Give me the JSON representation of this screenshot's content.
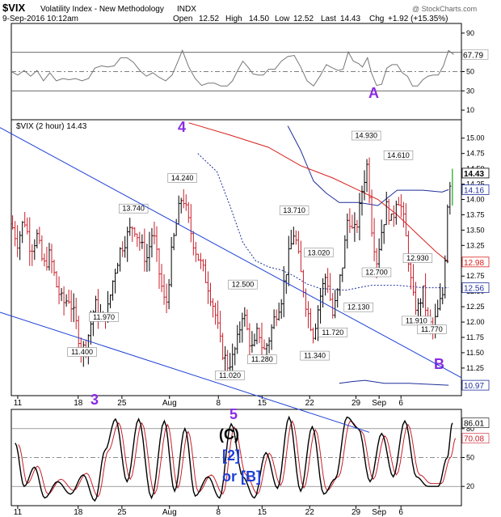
{
  "header": {
    "symbol": "$VIX",
    "name": "Volatility Index - New Methodology",
    "exchange": "INDX",
    "timestamp": "9-Sep-2016 10:12am",
    "watermark": "@ StockCharts.com",
    "open_label": "Open",
    "open": "12.52",
    "high_label": "High",
    "high": "14.50",
    "low_label": "Low",
    "low": "12.52",
    "last_label": "Last",
    "last": "14.43",
    "chg_label": "Chg",
    "chg": "+1.92 (+15.35%)"
  },
  "chart_data": [
    {
      "type": "line",
      "panel": "rsi",
      "ylim": [
        0,
        100
      ],
      "yticks": [
        "90",
        "70",
        "50",
        "30",
        "10"
      ],
      "reference_lines": [
        70,
        50,
        30
      ],
      "current_label": "67.79",
      "annotations": [
        "A"
      ]
    },
    {
      "type": "candlestick",
      "panel": "price",
      "legend": "$VIX (2 hour) 14.43",
      "ylim": [
        10.8,
        15.3
      ],
      "yticks": [
        "15.00",
        "14.75",
        "14.50",
        "14.25",
        "14.00",
        "13.75",
        "13.50",
        "13.25",
        "13.00",
        "12.75",
        "12.50",
        "12.25",
        "12.00",
        "11.75",
        "11.50",
        "11.25",
        "11.00"
      ],
      "price_labels": [
        {
          "t": 34.5,
          "v": 14.43,
          "text": "14.43"
        },
        {
          "t": 34.5,
          "v": 14.16,
          "text": "14.16"
        },
        {
          "t": 34.5,
          "v": 12.98,
          "text": "12.98"
        },
        {
          "t": 34.5,
          "v": 12.56,
          "text": "12.56"
        },
        {
          "t": 34.5,
          "v": 10.97,
          "text": "10.97"
        }
      ],
      "peak_labels": [
        {
          "t": 5.5,
          "v": 11.4,
          "text": "11.400"
        },
        {
          "t": 7.2,
          "v": 11.97,
          "text": "11.970"
        },
        {
          "t": 9.5,
          "v": 13.74,
          "text": "13.740"
        },
        {
          "t": 13.3,
          "v": 14.24,
          "text": "14.240"
        },
        {
          "t": 17.0,
          "v": 11.02,
          "text": "11.020"
        },
        {
          "t": 18.0,
          "v": 12.5,
          "text": "12.500"
        },
        {
          "t": 19.5,
          "v": 11.28,
          "text": "11.280"
        },
        {
          "t": 22.0,
          "v": 13.71,
          "text": "13.710"
        },
        {
          "t": 23.6,
          "v": 11.34,
          "text": "11.340"
        },
        {
          "t": 23.9,
          "v": 13.02,
          "text": "13.020"
        },
        {
          "t": 25.0,
          "v": 11.72,
          "text": "11.720"
        },
        {
          "t": 27.0,
          "v": 12.13,
          "text": "12.130"
        },
        {
          "t": 27.6,
          "v": 14.93,
          "text": "14.930"
        },
        {
          "t": 28.4,
          "v": 12.7,
          "text": "12.700"
        },
        {
          "t": 30.1,
          "v": 14.61,
          "text": "14.610"
        },
        {
          "t": 31.6,
          "v": 12.93,
          "text": "12.930"
        },
        {
          "t": 31.5,
          "v": 11.91,
          "text": "11.910"
        },
        {
          "t": 32.7,
          "v": 11.77,
          "text": "11.770"
        }
      ],
      "wave_labels": [
        {
          "text": "4",
          "color": "#8a2be2"
        },
        {
          "text": "B",
          "color": "#8a2be2"
        },
        {
          "text": "3",
          "color": "#8a2be2"
        },
        {
          "text": "5",
          "color": "#8a2be2"
        }
      ],
      "close_path": [
        {
          "t": 0.0,
          "v": 13.6
        },
        {
          "t": 0.5,
          "v": 13.3
        },
        {
          "t": 1.0,
          "v": 13.7
        },
        {
          "t": 1.5,
          "v": 13.2
        },
        {
          "t": 2.0,
          "v": 13.4
        },
        {
          "t": 2.5,
          "v": 12.9
        },
        {
          "t": 3.0,
          "v": 13.1
        },
        {
          "t": 3.5,
          "v": 12.6
        },
        {
          "t": 4.0,
          "v": 12.3
        },
        {
          "t": 4.5,
          "v": 12.4
        },
        {
          "t": 5.0,
          "v": 12.0
        },
        {
          "t": 5.5,
          "v": 11.5
        },
        {
          "t": 6.0,
          "v": 11.8
        },
        {
          "t": 6.5,
          "v": 12.3
        },
        {
          "t": 7.0,
          "v": 12.0
        },
        {
          "t": 7.5,
          "v": 12.2
        },
        {
          "t": 8.0,
          "v": 12.8
        },
        {
          "t": 8.5,
          "v": 13.2
        },
        {
          "t": 9.0,
          "v": 13.4
        },
        {
          "t": 9.5,
          "v": 13.6
        },
        {
          "t": 10.0,
          "v": 13.3
        },
        {
          "t": 10.5,
          "v": 13.0
        },
        {
          "t": 11.0,
          "v": 13.5
        },
        {
          "t": 11.5,
          "v": 12.8
        },
        {
          "t": 12.0,
          "v": 12.2
        },
        {
          "t": 12.5,
          "v": 13.2
        },
        {
          "t": 13.0,
          "v": 13.8
        },
        {
          "t": 13.3,
          "v": 14.1
        },
        {
          "t": 13.8,
          "v": 13.6
        },
        {
          "t": 14.3,
          "v": 13.2
        },
        {
          "t": 14.8,
          "v": 12.9
        },
        {
          "t": 15.3,
          "v": 12.6
        },
        {
          "t": 15.8,
          "v": 12.2
        },
        {
          "t": 16.3,
          "v": 11.6
        },
        {
          "t": 16.8,
          "v": 11.3
        },
        {
          "t": 17.2,
          "v": 11.4
        },
        {
          "t": 17.6,
          "v": 11.7
        },
        {
          "t": 18.0,
          "v": 12.2
        },
        {
          "t": 18.4,
          "v": 11.8
        },
        {
          "t": 18.8,
          "v": 11.5
        },
        {
          "t": 19.2,
          "v": 11.9
        },
        {
          "t": 19.6,
          "v": 11.5
        },
        {
          "t": 20.0,
          "v": 11.7
        },
        {
          "t": 20.5,
          "v": 12.1
        },
        {
          "t": 21.0,
          "v": 12.4
        },
        {
          "t": 21.5,
          "v": 13.0
        },
        {
          "t": 22.0,
          "v": 13.5
        },
        {
          "t": 22.5,
          "v": 12.8
        },
        {
          "t": 23.0,
          "v": 12.2
        },
        {
          "t": 23.5,
          "v": 11.8
        },
        {
          "t": 24.0,
          "v": 12.4
        },
        {
          "t": 24.5,
          "v": 12.8
        },
        {
          "t": 25.0,
          "v": 12.1
        },
        {
          "t": 25.4,
          "v": 12.5
        },
        {
          "t": 25.8,
          "v": 13.0
        },
        {
          "t": 26.2,
          "v": 13.8
        },
        {
          "t": 26.6,
          "v": 13.4
        },
        {
          "t": 27.0,
          "v": 13.7
        },
        {
          "t": 27.3,
          "v": 14.2
        },
        {
          "t": 27.7,
          "v": 14.6
        },
        {
          "t": 28.0,
          "v": 13.6
        },
        {
          "t": 28.4,
          "v": 13.0
        },
        {
          "t": 28.8,
          "v": 13.5
        },
        {
          "t": 29.2,
          "v": 13.9
        },
        {
          "t": 29.6,
          "v": 13.6
        },
        {
          "t": 30.0,
          "v": 14.1
        },
        {
          "t": 30.4,
          "v": 13.8
        },
        {
          "t": 30.8,
          "v": 13.2
        },
        {
          "t": 31.2,
          "v": 12.4
        },
        {
          "t": 31.6,
          "v": 12.2
        },
        {
          "t": 32.0,
          "v": 12.5
        },
        {
          "t": 32.4,
          "v": 12.0
        },
        {
          "t": 32.8,
          "v": 11.9
        },
        {
          "t": 33.2,
          "v": 12.2
        },
        {
          "t": 33.6,
          "v": 12.5
        },
        {
          "t": 34.0,
          "v": 14.3
        }
      ],
      "ma_red": [
        {
          "t": 13.8,
          "v": 15.25
        },
        {
          "t": 17,
          "v": 15.05
        },
        {
          "t": 20,
          "v": 14.85
        },
        {
          "t": 22.5,
          "v": 14.55
        },
        {
          "t": 25,
          "v": 14.35
        },
        {
          "t": 27,
          "v": 14.15
        },
        {
          "t": 28.5,
          "v": 14.0
        },
        {
          "t": 30,
          "v": 13.75
        },
        {
          "t": 31.5,
          "v": 13.45
        },
        {
          "t": 33,
          "v": 13.15
        },
        {
          "t": 34,
          "v": 12.98
        }
      ],
      "bb_upper": [
        {
          "t": 21.5,
          "v": 15.2
        },
        {
          "t": 22.5,
          "v": 14.8
        },
        {
          "t": 23.5,
          "v": 14.3
        },
        {
          "t": 24.5,
          "v": 14.1
        },
        {
          "t": 25.5,
          "v": 13.95
        },
        {
          "t": 27,
          "v": 13.95
        },
        {
          "t": 28.5,
          "v": 13.9
        },
        {
          "t": 30,
          "v": 14.15
        },
        {
          "t": 32,
          "v": 14.15
        },
        {
          "t": 33.5,
          "v": 14.12
        },
        {
          "t": 34,
          "v": 14.16
        }
      ],
      "bb_lower": [
        {
          "t": 25.5,
          "v": 11.0
        },
        {
          "t": 26.5,
          "v": 11.03
        },
        {
          "t": 27.5,
          "v": 11.05
        },
        {
          "t": 29,
          "v": 11.0
        },
        {
          "t": 31,
          "v": 11.0
        },
        {
          "t": 33,
          "v": 10.98
        },
        {
          "t": 34,
          "v": 10.97
        }
      ],
      "dotted": [
        {
          "t": 14.5,
          "v": 14.75
        },
        {
          "t": 16,
          "v": 14.45
        },
        {
          "t": 17,
          "v": 13.9
        },
        {
          "t": 18,
          "v": 13.3
        },
        {
          "t": 19,
          "v": 13.0
        },
        {
          "t": 20,
          "v": 12.9
        },
        {
          "t": 21,
          "v": 12.85
        },
        {
          "t": 22,
          "v": 12.75
        },
        {
          "t": 23,
          "v": 12.62
        },
        {
          "t": 24,
          "v": 12.55
        },
        {
          "t": 26,
          "v": 12.52
        },
        {
          "t": 28,
          "v": 12.6
        },
        {
          "t": 30,
          "v": 12.6
        },
        {
          "t": 32,
          "v": 12.56
        },
        {
          "t": 34,
          "v": 12.56
        }
      ],
      "trendlines": [
        {
          "t1": 0.2,
          "v1": 15.05,
          "t2": 34.5,
          "v2": 11.15
        },
        {
          "t1": 0.0,
          "v1": 12.1,
          "t2": 19.8,
          "v2": 10.75
        }
      ]
    },
    {
      "type": "line",
      "panel": "stochastic",
      "ylim": [
        0,
        100
      ],
      "yticks": [
        "80",
        "50",
        "20"
      ],
      "current_labels": [
        "86.01",
        "70.08"
      ],
      "annotations": [
        {
          "text": "(C)",
          "color": "#000000"
        },
        {
          "text": "[2]",
          "color": "#1d3fd6"
        },
        {
          "text": "or [B]",
          "color": "#1d3fd6"
        }
      ],
      "peaks": [
        {
          "t": 0.3,
          "v": 65
        },
        {
          "t": 1.0,
          "v": 20
        },
        {
          "t": 1.8,
          "v": 40
        },
        {
          "t": 2.6,
          "v": 8
        },
        {
          "t": 3.6,
          "v": 25
        },
        {
          "t": 4.6,
          "v": 12
        },
        {
          "t": 5.6,
          "v": 32
        },
        {
          "t": 6.5,
          "v": 5
        },
        {
          "t": 7.3,
          "v": 58
        },
        {
          "t": 8.1,
          "v": 90
        },
        {
          "t": 9.0,
          "v": 25
        },
        {
          "t": 9.9,
          "v": 90
        },
        {
          "t": 10.9,
          "v": 8
        },
        {
          "t": 11.9,
          "v": 88
        },
        {
          "t": 12.7,
          "v": 15
        },
        {
          "t": 13.5,
          "v": 80
        },
        {
          "t": 14.3,
          "v": 10
        },
        {
          "t": 15.3,
          "v": 30
        },
        {
          "t": 16.2,
          "v": 8
        },
        {
          "t": 17.1,
          "v": 85
        },
        {
          "t": 18.0,
          "v": 30
        },
        {
          "t": 18.9,
          "v": 8
        },
        {
          "t": 19.8,
          "v": 55
        },
        {
          "t": 20.7,
          "v": 18
        },
        {
          "t": 21.6,
          "v": 92
        },
        {
          "t": 22.5,
          "v": 15
        },
        {
          "t": 23.4,
          "v": 82
        },
        {
          "t": 24.3,
          "v": 12
        },
        {
          "t": 25.2,
          "v": 28
        },
        {
          "t": 26.1,
          "v": 92
        },
        {
          "t": 27.0,
          "v": 80
        },
        {
          "t": 27.9,
          "v": 25
        },
        {
          "t": 28.8,
          "v": 75
        },
        {
          "t": 29.7,
          "v": 30
        },
        {
          "t": 30.6,
          "v": 88
        },
        {
          "t": 31.5,
          "v": 30
        },
        {
          "t": 32.4,
          "v": 20
        },
        {
          "t": 33.2,
          "v": 20
        },
        {
          "t": 33.9,
          "v": 50
        },
        {
          "t": 34.3,
          "v": 86
        }
      ]
    }
  ],
  "xaxis": {
    "ticks": [
      {
        "t": 0.5,
        "text": "11"
      },
      {
        "t": 5.2,
        "text": "18"
      },
      {
        "t": 8.6,
        "text": "25"
      },
      {
        "t": 12.3,
        "text": "Aug"
      },
      {
        "t": 16.1,
        "text": "8"
      },
      {
        "t": 19.5,
        "text": "15"
      },
      {
        "t": 23.2,
        "text": "22"
      },
      {
        "t": 26.8,
        "text": "29"
      },
      {
        "t": 28.6,
        "text": "Sep"
      },
      {
        "t": 30.3,
        "text": "6"
      }
    ]
  },
  "colors": {
    "candle_up": "#000000",
    "candle_down": "#c8202b",
    "bb": "#1f2f9a",
    "ma": "#d9201c",
    "trend": "#1d3fd6",
    "wave": "#8a2be2",
    "stoch_k": "#000000",
    "stoch_d": "#c8202b",
    "rsi": "#777777"
  }
}
